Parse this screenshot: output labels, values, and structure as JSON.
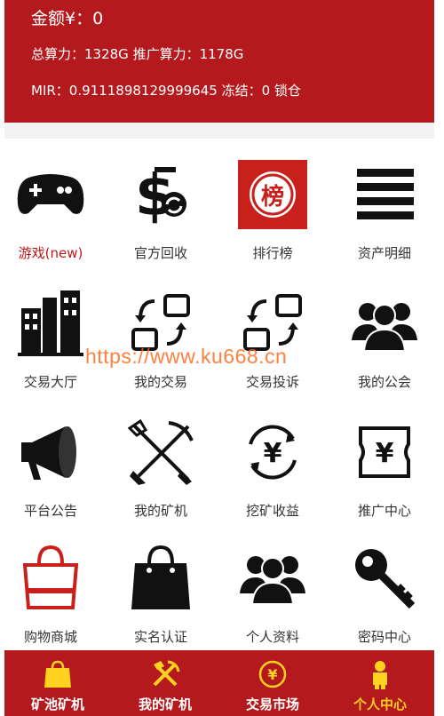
{
  "header": {
    "amount": "金额¥：0",
    "power": "总算力：1328G 推广算力：1178G",
    "mir": "MIR：0.9111898129999645 冻结：0 锁仓"
  },
  "grid": [
    {
      "label": "游戏(new)",
      "icon": "gamepad-icon"
    },
    {
      "label": "官方回收",
      "icon": "dollar-recycle-icon"
    },
    {
      "label": "排行榜",
      "icon": "ranking-icon"
    },
    {
      "label": "资产明细",
      "icon": "list-lines-icon"
    },
    {
      "label": "交易大厅",
      "icon": "buildings-icon"
    },
    {
      "label": "我的交易",
      "icon": "exchange-icon"
    },
    {
      "label": "交易投诉",
      "icon": "exchange-complaint-icon"
    },
    {
      "label": "我的公会",
      "icon": "group-icon"
    },
    {
      "label": "平台公告",
      "icon": "megaphone-icon"
    },
    {
      "label": "我的矿机",
      "icon": "pickaxe-shovel-icon"
    },
    {
      "label": "挖矿收益",
      "icon": "yen-cycle-icon"
    },
    {
      "label": "推广中心",
      "icon": "yen-ticket-icon"
    },
    {
      "label": "购物商城",
      "icon": "shopping-bag-outline-icon"
    },
    {
      "label": "实名认证",
      "icon": "shopping-bag-filled-icon"
    },
    {
      "label": "个人资料",
      "icon": "people-icon"
    },
    {
      "label": "密码中心",
      "icon": "key-icon"
    }
  ],
  "ranking_badge": "榜",
  "watermark": "https://www.ku668.cn",
  "tabbar": [
    {
      "label": "矿池矿机",
      "icon": "bag-icon"
    },
    {
      "label": "我的矿机",
      "icon": "hammer-pick-icon"
    },
    {
      "label": "交易市场",
      "icon": "yen-circle-icon"
    },
    {
      "label": "个人中心",
      "icon": "person-icon"
    }
  ],
  "colors": {
    "brand_red": "#b4191d",
    "tab_active": "#ffd21f",
    "tab_inactive": "#ffffff",
    "game_label": "#c01818"
  }
}
